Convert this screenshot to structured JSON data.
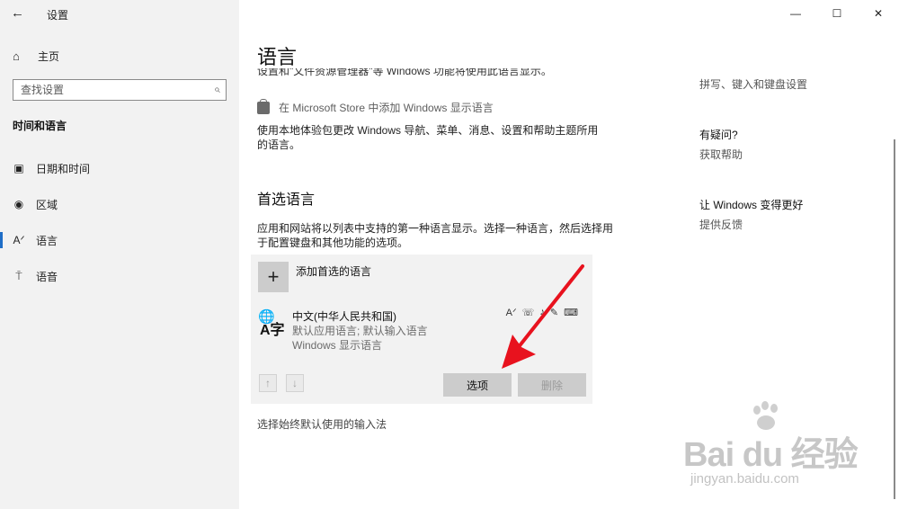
{
  "window": {
    "title": "设置",
    "back_icon": "←",
    "minimize_icon": "—",
    "maximize_icon": "☐",
    "close_icon": "✕"
  },
  "sidebar": {
    "home": {
      "icon": "⌂",
      "label": "主页"
    },
    "search": {
      "placeholder": "查找设置",
      "icon": "⌕"
    },
    "section_title": "时间和语言",
    "items": [
      {
        "icon": "▣",
        "label": "日期和时间"
      },
      {
        "icon": "◉",
        "label": "区域"
      },
      {
        "icon": "Aᐟ",
        "label": "语言"
      },
      {
        "icon": "⍑",
        "label": "语音"
      }
    ]
  },
  "main": {
    "title": "语言",
    "cut_text": "设置和\"文件资源管理器\"等 Windows 功能将使用此语言显示。",
    "store_link": "在 Microsoft Store 中添加 Windows 显示语言",
    "experience_desc": "使用本地体验包更改 Windows 导航、菜单、消息、设置和帮助主题所用的语言。",
    "preferred_title": "首选语言",
    "preferred_desc": "应用和网站将以列表中支持的第一种语言显示。选择一种语言，然后选择用于配置键盘和其他功能的选项。",
    "add_button_icon": "+",
    "add_label": "添加首选的语言",
    "language": {
      "name": "中文(中华人民共和国)",
      "line1": "默认应用语言; 默认输入语言",
      "line2": "Windows 显示语言",
      "icon_globe": "🌐",
      "icon_char": "A字",
      "features": [
        "Aᐟ",
        "☏",
        "♪",
        "✎",
        "⌨"
      ]
    },
    "up_icon": "↑",
    "down_icon": "↓",
    "options_button": "选项",
    "remove_button": "删除",
    "input_method_link": "选择始终默认使用的输入法"
  },
  "right": {
    "link1": "拼写、键入和键盘设置",
    "help_head": "有疑问?",
    "help_link": "获取帮助",
    "improve_head": "让 Windows 变得更好",
    "feedback_link": "提供反馈"
  },
  "watermark": {
    "main": "Bai du 经验",
    "sub": "jingyan.baidu.com"
  },
  "colors": {
    "accent": "#1f6ec7",
    "annotation": "#e8121e"
  }
}
